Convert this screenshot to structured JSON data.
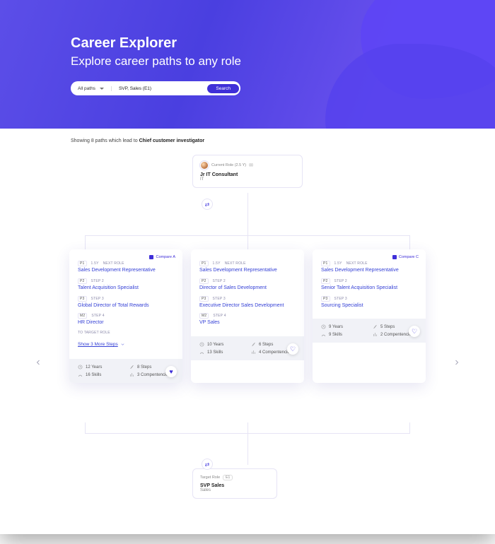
{
  "hero": {
    "title": "Career Explorer",
    "subtitle": "Explore career paths to any role",
    "filter_label": "All paths",
    "query_value": "SVP, Sales (E1)",
    "search_label": "Search"
  },
  "results": {
    "prefix": "Showing",
    "count": "8",
    "mid": "paths which lead to",
    "target": "Chief customer investigator"
  },
  "current_node": {
    "tag": "Current Role (2.5 Y)",
    "role": "Jr IT Consultant",
    "dept": "IT"
  },
  "target_node": {
    "tag": "Target Role",
    "level": "E1",
    "role": "SVP Sales",
    "dept": "Sales"
  },
  "cards": [
    {
      "compare": "Compare A",
      "duration": "1.5Y",
      "next_label": "NEXT ROLE",
      "steps": [
        {
          "lvl": "P1",
          "stage": "",
          "role": "Sales Development Representative"
        },
        {
          "lvl": "P2",
          "stage": "STEP 2",
          "role": "Talent Acquisition Specialist"
        },
        {
          "lvl": "P3",
          "stage": "STEP 3",
          "role": "Global Director of Total Rewards"
        },
        {
          "lvl": "M2",
          "stage": "STEP 4",
          "role": "HR Director"
        }
      ],
      "to_target_label": "TO TARGET ROLE",
      "more": "Show 3 More Steps",
      "foot": {
        "years": "12 Years",
        "steps": "8 Steps",
        "skills": "16 Skills",
        "comp": "3 Compentencies"
      },
      "liked": true
    },
    {
      "compare": "",
      "duration": "1.5Y",
      "next_label": "NEXT ROLE",
      "steps": [
        {
          "lvl": "P1",
          "stage": "",
          "role": "Sales Development Representative"
        },
        {
          "lvl": "P2",
          "stage": "STEP 2",
          "role": "Director of Sales Development"
        },
        {
          "lvl": "P3",
          "stage": "STEP 3",
          "role": "Executive Director Sales Development"
        },
        {
          "lvl": "M2",
          "stage": "STEP 4",
          "role": "VP Sales"
        }
      ],
      "to_target_label": "",
      "more": "",
      "foot": {
        "years": "10 Years",
        "steps": "6 Steps",
        "skills": "13 Skills",
        "comp": "4 Compentencies"
      },
      "liked": false
    },
    {
      "compare": "Compare C",
      "duration": "1.5Y",
      "next_label": "NEXT ROLE",
      "steps": [
        {
          "lvl": "P1",
          "stage": "",
          "role": "Sales Development Representative"
        },
        {
          "lvl": "P2",
          "stage": "STEP 2",
          "role": "Senior Talent Acquisition Specialist"
        },
        {
          "lvl": "P3",
          "stage": "STEP 3",
          "role": "Sourcing Specialist"
        }
      ],
      "to_target_label": "",
      "more": "",
      "foot": {
        "years": "9 Years",
        "steps": "5 Steps",
        "skills": "9 Skills",
        "comp": "2 Compentencies"
      },
      "liked": false
    }
  ]
}
